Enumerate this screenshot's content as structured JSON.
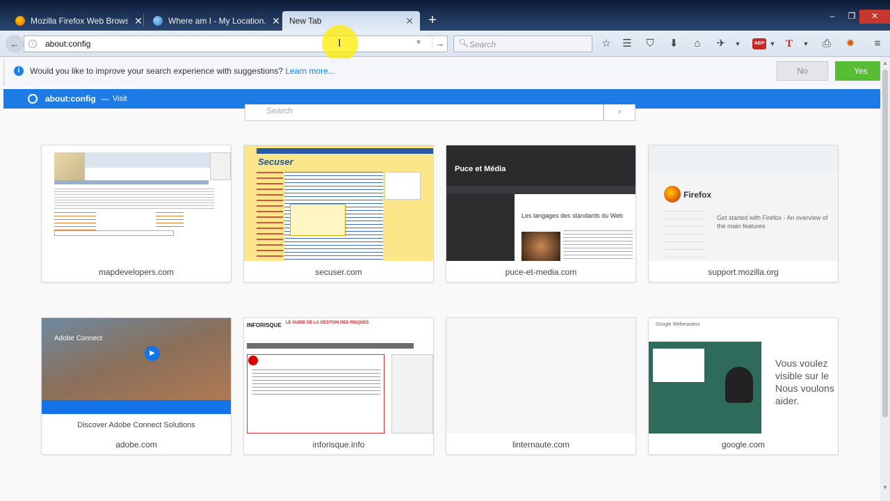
{
  "browser": {
    "tabs": [
      {
        "title": "Mozilla Firefox Web Brows...",
        "active": false
      },
      {
        "title": "Where am I - My Location...",
        "active": false
      },
      {
        "title": "New Tab",
        "active": true
      }
    ],
    "new_tab_symbol": "+",
    "window_controls": {
      "minimize": "–",
      "maximize": "❐",
      "close": "✕"
    }
  },
  "navbar": {
    "url": "about:config",
    "search_placeholder": "Search",
    "icons": [
      "back-icon",
      "bookmark-star-icon",
      "reading-list-icon",
      "pocket-icon",
      "download-icon",
      "home-icon",
      "extension-icon",
      "adblock-icon",
      "font-icon",
      "print-icon",
      "firebug-icon",
      "menu-icon"
    ],
    "adblock_label": "ABP"
  },
  "suggestions_prompt": {
    "text": "Would you like to improve your search experience with suggestions?",
    "link": "Learn more...",
    "no_label": "No",
    "yes_label": "Yes",
    "colors": {
      "yes": "#57bd35",
      "link": "#0a84ff"
    }
  },
  "autocomplete": {
    "title": "about:config",
    "separator": "—",
    "action": "Visit",
    "highlight_color": "#1c7be5"
  },
  "newtab": {
    "search_placeholder": "Search",
    "tiles": [
      {
        "label": "mapdevelopers.com",
        "caption": ""
      },
      {
        "label": "secuser.com",
        "caption": ""
      },
      {
        "label": "puce-et-media.com",
        "caption": ""
      },
      {
        "label": "support.mozilla.org",
        "caption": ""
      },
      {
        "label": "adobe.com",
        "caption": "Discover Adobe Connect Solutions"
      },
      {
        "label": "inforisque.info",
        "caption": ""
      },
      {
        "label": "linternaute.com",
        "caption": ""
      },
      {
        "label": "google.com",
        "caption": ""
      }
    ],
    "thumb_text": {
      "puce_title": "Puce et Média",
      "puce_headline": "Les langages des standards du Web",
      "mozilla_brand": "Firefox",
      "mozilla_headline": "Get started with Firefox - An overview of the main features",
      "adobe_brand": "Adobe Connect",
      "inforisque_brand": "INFORISQUE",
      "inforisque_heading": "LE GUIDE DE LA GESTION DES RISQUES",
      "google_brand": "Google Webmasters",
      "google_headline": "Vous voulez visible sur le Nous voulons aider.",
      "secuser_brand": "Secuser"
    }
  }
}
